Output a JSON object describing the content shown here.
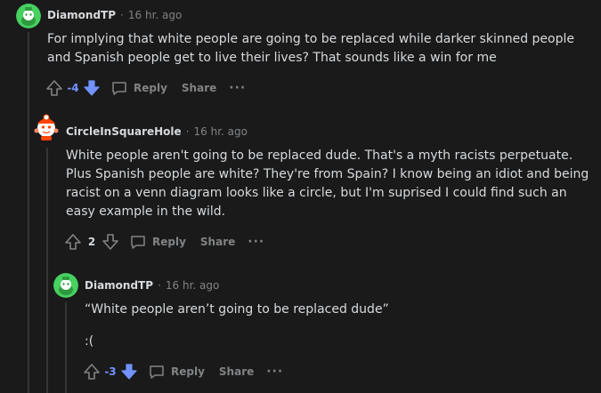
{
  "colors": {
    "background": "#1a1a1b",
    "text": "#d7dadc",
    "muted": "#818384",
    "downvote_active": "#7193ff",
    "thread_line": "#343536",
    "avatar_green": "#46d160"
  },
  "comments": [
    {
      "username": "DiamondTP",
      "separator": "·",
      "time": "16 hr. ago",
      "avatar": "snoo-green-avatar",
      "body": [
        "For implying that white people are going to be replaced while darker skinned people and Spanish people get to live their lives? That sounds like a win for me"
      ],
      "score": "-4",
      "vote_state": "downvoted",
      "reply_label": "Reply",
      "share_label": "Share",
      "more_label": "···"
    },
    {
      "username": "CircleInSquareHole",
      "separator": "·",
      "time": "16 hr. ago",
      "avatar": "snoo-red-white-avatar",
      "body": [
        "White people aren't going to be replaced dude. That's a myth racists perpetuate. Plus Spanish people are white? They're from Spain? I know being an idiot and being racist on a venn diagram looks like a circle, but I'm suprised I could find such an easy example in the wild."
      ],
      "score": "2",
      "vote_state": "none",
      "reply_label": "Reply",
      "share_label": "Share",
      "more_label": "···"
    },
    {
      "username": "DiamondTP",
      "separator": "·",
      "time": "16 hr. ago",
      "avatar": "snoo-green-avatar",
      "body": [
        "“White people aren’t going to be replaced dude”",
        ":("
      ],
      "score": "-3",
      "vote_state": "downvoted",
      "reply_label": "Reply",
      "share_label": "Share",
      "more_label": "···"
    }
  ]
}
